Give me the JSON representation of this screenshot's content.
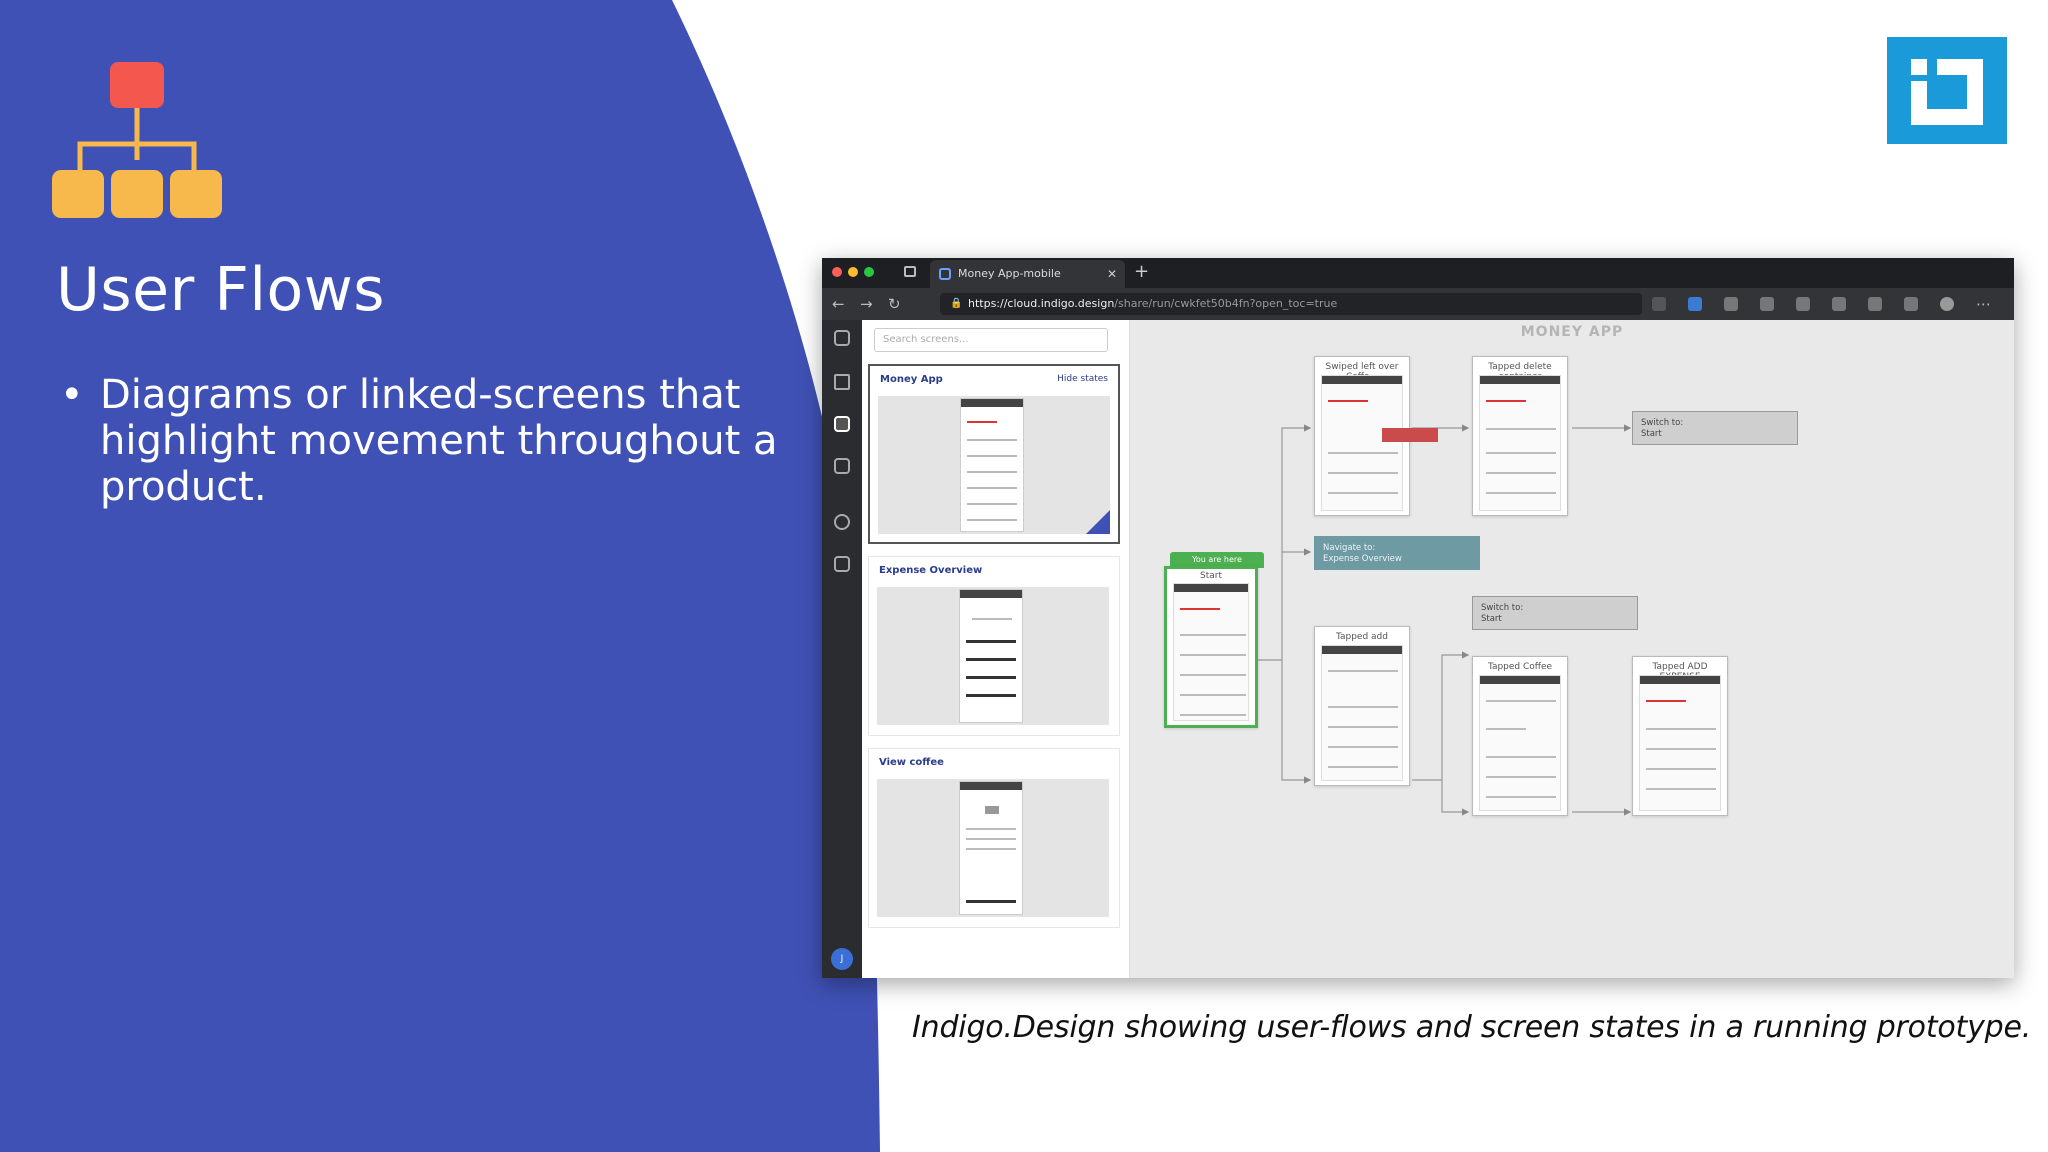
{
  "slide": {
    "title": "User Flows",
    "bullet": "Diagrams or linked-screens that highlight movement throughout a product.",
    "caption": "Indigo.Design showing user-flows and screen states in a running prototype.",
    "colors": {
      "blue_panel": "#3f51b5",
      "icon_red": "#f4574d",
      "icon_orange": "#f7b94c",
      "logo_blue": "#1a9ad9"
    }
  },
  "browser": {
    "tab_title": "Money App-mobile",
    "url_host": "https://cloud.indigo.design",
    "url_path": "/share/run/cwkfet50b4fn?open_toc=true"
  },
  "screens_panel": {
    "search_placeholder": "Search screens...",
    "hide_states": "Hide states",
    "screens": [
      {
        "name": "Money App"
      },
      {
        "name": "Expense Overview"
      },
      {
        "name": "View coffee"
      }
    ]
  },
  "canvas": {
    "title": "MONEY APP",
    "you_are_here": "You are here",
    "nodes": {
      "start": "Start",
      "swiped": "Swiped left over Coffe...",
      "tapped_delete": "Tapped delete container",
      "tapped_add": "Tapped add",
      "tapped_coffee": "Tapped Coffee",
      "tapped_add_expense": "Tapped ADD EXPENSE"
    },
    "actions": {
      "switch1": {
        "line1": "Switch to:",
        "line2": "Start"
      },
      "navigate": {
        "line1": "Navigate to:",
        "line2": "Expense Overview"
      },
      "switch2": {
        "line1": "Switch to:",
        "line2": "Start"
      }
    }
  }
}
